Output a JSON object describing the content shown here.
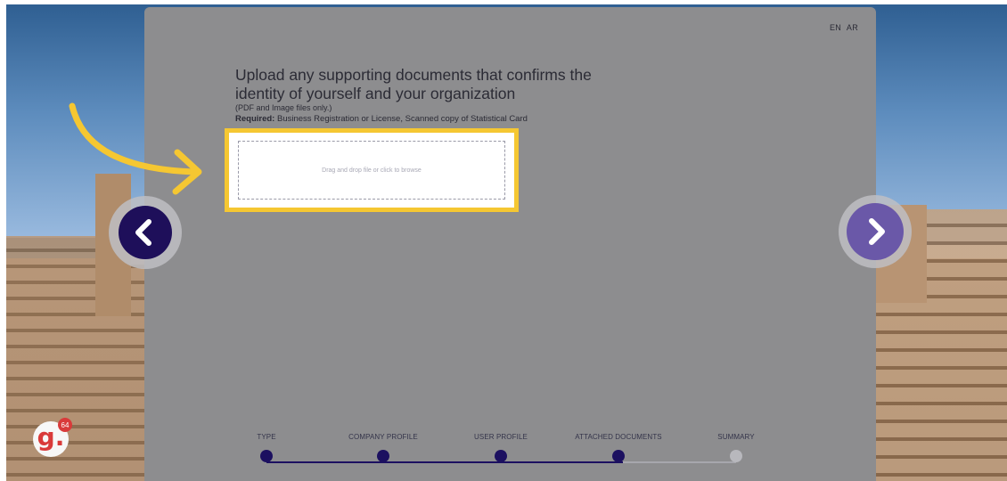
{
  "language": {
    "en": "EN",
    "ar": "AR"
  },
  "upload": {
    "title": "Upload any supporting documents that confirms the identity of yourself and your organization",
    "file_types": "(PDF and Image files only.)",
    "required_label": "Required:",
    "required_text": "Business Registration or License, Scanned copy of Statistical Card",
    "dropzone_text": "Drag and drop file or click to browse"
  },
  "steps": [
    {
      "label": "TYPE",
      "status": "completed"
    },
    {
      "label": "COMPANY PROFILE",
      "status": "completed"
    },
    {
      "label": "USER PROFILE",
      "status": "completed"
    },
    {
      "label": "ATTACHED DOCUMENTS",
      "status": "current"
    },
    {
      "label": "SUMMARY",
      "status": "pending"
    }
  ],
  "logo": {
    "letter": "g.",
    "badge": "64"
  },
  "icons": {
    "prev": "chevron-left-icon",
    "next": "chevron-right-icon",
    "pointer": "curved-arrow-icon"
  },
  "colors": {
    "accent": "#1c1060",
    "highlight": "#f5c732",
    "next_button": "#6a58a8",
    "logo": "#d93a3a"
  }
}
